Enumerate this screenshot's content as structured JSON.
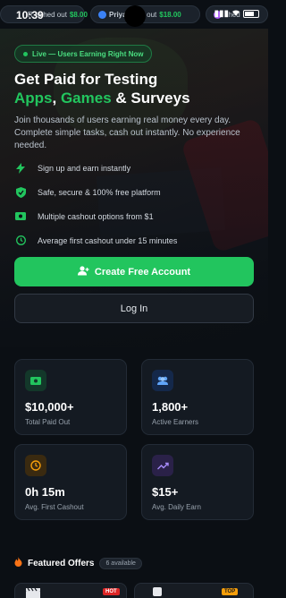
{
  "status": {
    "time": "10:39",
    "signal": "▮▮▮"
  },
  "ticker": [
    {
      "name": "R",
      "action": "ashed out",
      "amount": "$8.00"
    },
    {
      "name": "Priya",
      "action": "shed out",
      "amount": "$18.00"
    },
    {
      "name": "",
      "action": "shed",
      "amount": ""
    }
  ],
  "hero": {
    "live_badge": "Live — Users Earning Right Now",
    "headline_line1": "Get Paid for Testing",
    "headline_apps": "Apps",
    "headline_sep1": ", ",
    "headline_games": "Games",
    "headline_sep2": " & Surveys",
    "subtitle": "Join thousands of users earning real money every day. Complete simple tasks, cash out instantly. No experience needed.",
    "features": [
      {
        "icon": "bolt-icon",
        "text": "Sign up and earn instantly"
      },
      {
        "icon": "shield-icon",
        "text": "Safe, secure & 100% free platform"
      },
      {
        "icon": "cash-icon",
        "text": "Multiple cashout options from $1"
      },
      {
        "icon": "clock-icon",
        "text": "Average first cashout under 15 minutes"
      }
    ],
    "primary_button": "Create Free Account",
    "secondary_button": "Log In"
  },
  "stats": [
    {
      "icon": "money-icon",
      "value": "$10,000+",
      "label": "Total Paid Out",
      "icon_color": "#22c55e",
      "icon_bg": "#13382a"
    },
    {
      "icon": "users-icon",
      "value": "1,800+",
      "label": "Active Earners",
      "icon_color": "#60a5fa",
      "icon_bg": "#14284a"
    },
    {
      "icon": "clock-icon",
      "value": "0h 15m",
      "label": "Avg. First Cashout",
      "icon_color": "#f59e0b",
      "icon_bg": "#3a2a10"
    },
    {
      "icon": "trend-icon",
      "value": "$15+",
      "label": "Avg. Daily Earn",
      "icon_color": "#a78bfa",
      "icon_bg": "#2a2148"
    }
  ],
  "offers": {
    "title": "Featured Offers",
    "count": "6 available",
    "hot_tag": "HOT",
    "top_tag": "TOP"
  },
  "colors": {
    "accent": "#22c55e",
    "background": "#0b0f14",
    "card": "#141a22"
  }
}
